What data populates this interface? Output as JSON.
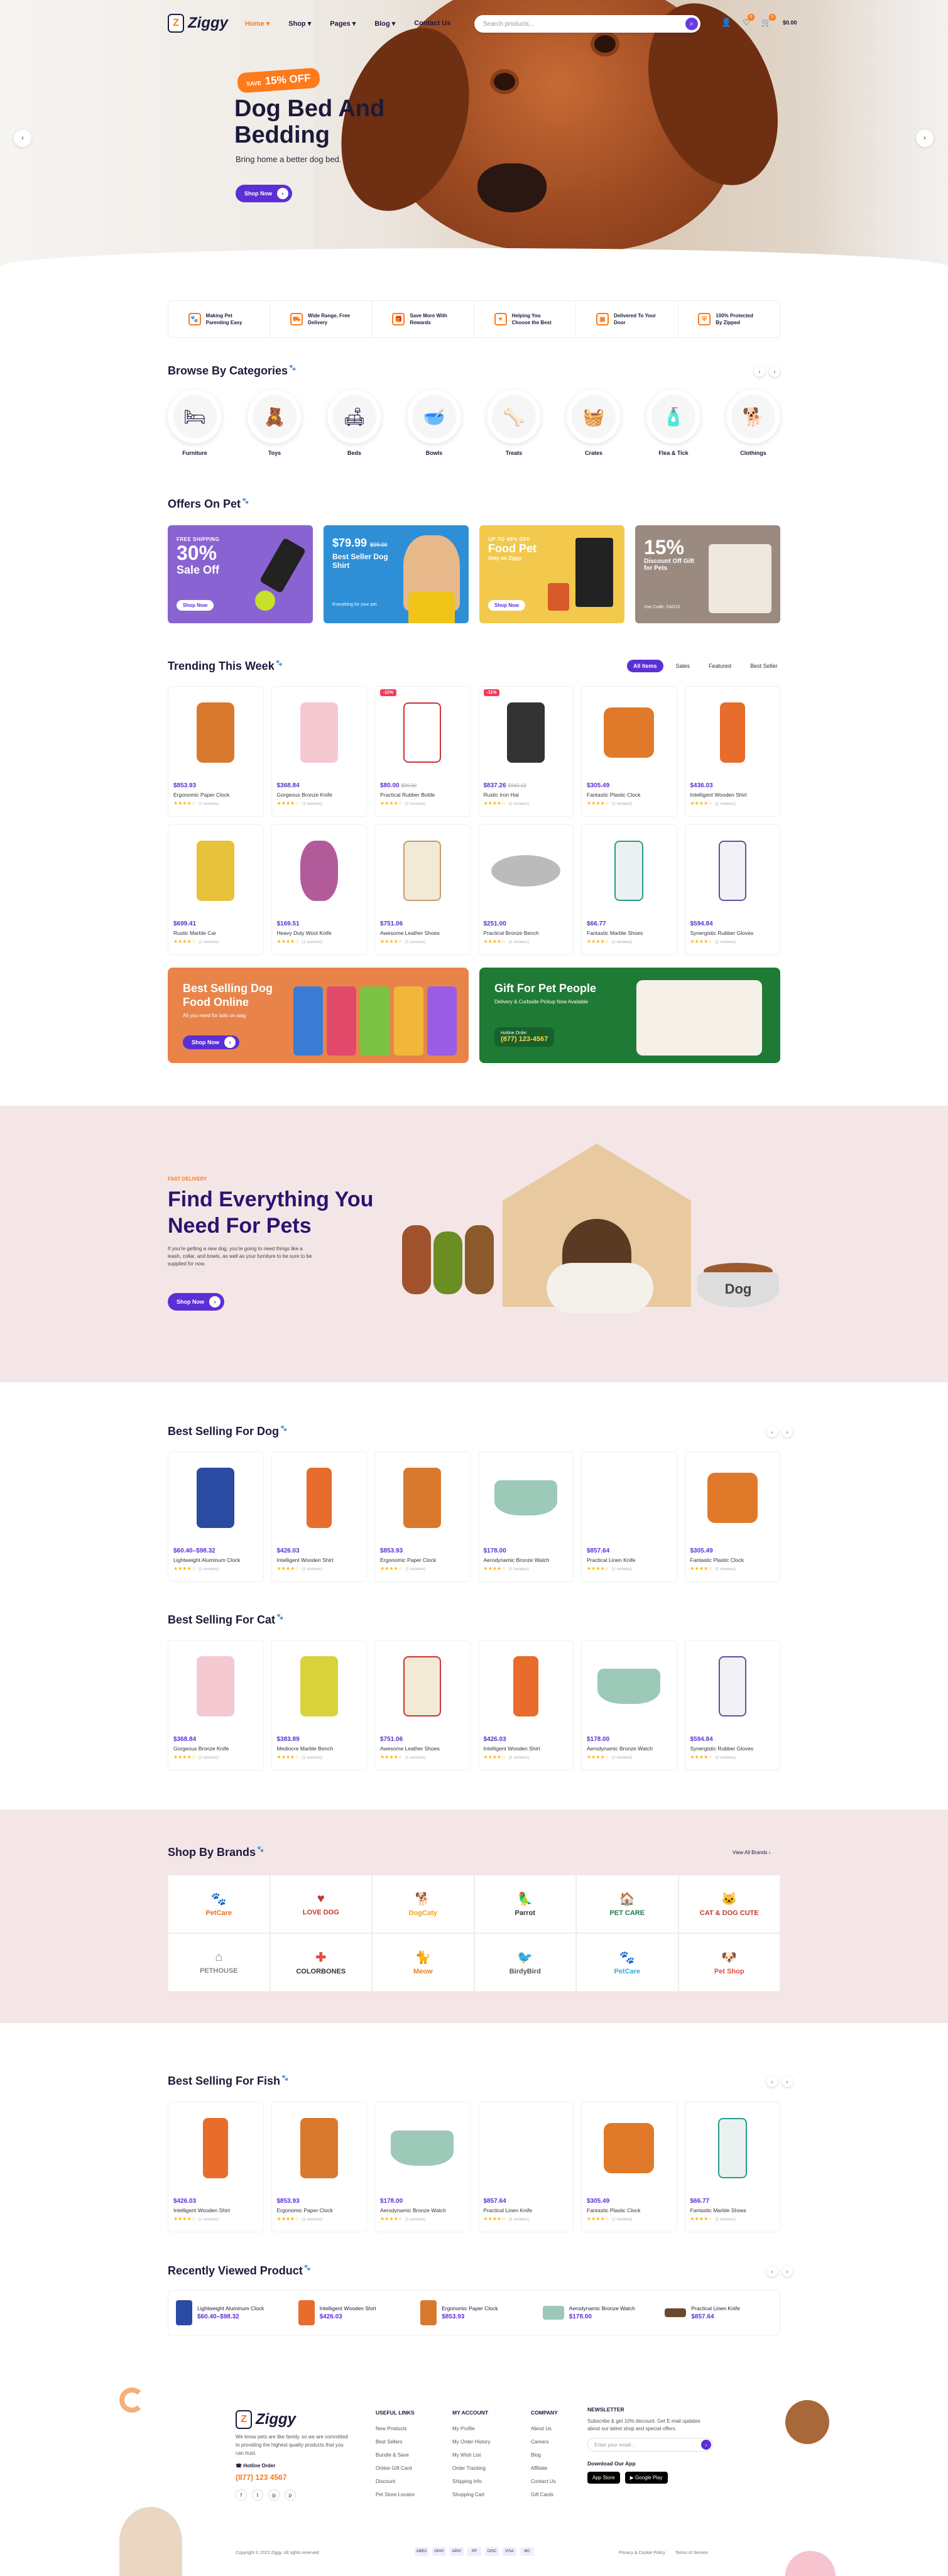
{
  "header": {
    "logo": "Ziggy",
    "nav": [
      "Home",
      "Shop",
      "Pages",
      "Blog",
      "Contact Us"
    ],
    "search_placeholder": "Search products...",
    "cart_total": "$0.00",
    "wishlist_count": "0",
    "cart_count": "0"
  },
  "hero": {
    "tag_small": "SAVE",
    "tag": "15% OFF",
    "title": "Dog Bed And Bedding",
    "subtitle": "Bring home a better dog bed.",
    "button": "Shop Now"
  },
  "features": [
    {
      "icon": "paw-icon",
      "text": "Making Pet Parenting Easy"
    },
    {
      "icon": "truck-icon",
      "text": "Wide Range, Free Delivery"
    },
    {
      "icon": "gift-icon",
      "text": "Save More With Rewards"
    },
    {
      "icon": "heart-icon",
      "text": "Helping You Choose the Best"
    },
    {
      "icon": "box-icon",
      "text": "Delivered To Your Door"
    },
    {
      "icon": "shield-icon",
      "text": "100% Protected By Zipped"
    }
  ],
  "categories_title": "Browse By Categories",
  "categories": [
    "Furniture",
    "Toys",
    "Beds",
    "Bowls",
    "Treats",
    "Crates",
    "Flea & Tick",
    "Clothings"
  ],
  "offers_title": "Offers On Pet",
  "offers": [
    {
      "line1": "FREE SHIPPING",
      "big": "30%",
      "line2": "Sale Off",
      "button": "Shop Now",
      "color": "#8a63d2"
    },
    {
      "line1": "",
      "big": "$79.99",
      "old": "$99.00",
      "line2": "Best Seller Dog Shirt",
      "note": "Everything for your pet.",
      "color": "#2f8fd6"
    },
    {
      "line1": "UP TO 40% OFF",
      "big": "Food Pet",
      "line2": "Only on Ziggy",
      "button": "Shop Now",
      "color": "#f2c94c"
    },
    {
      "line1": "",
      "big": "15%",
      "line2": "Discount Off Gift for Pets",
      "note": "Use Code: ZAG15",
      "color": "#9a8a80"
    }
  ],
  "trending_title": "Trending This Week",
  "trending_tabs": [
    "All Items",
    "Sales",
    "Featured",
    "Best Seller"
  ],
  "trending_row1": [
    {
      "price": "$853.93",
      "name": "Ergonomic Paper Clock",
      "sale": ""
    },
    {
      "price": "$368.84",
      "name": "Gorgeous Bronze Knife",
      "sale": ""
    },
    {
      "price": "$80.00",
      "old": "$90.00",
      "name": "Practical Rubber Bottle",
      "sale": "-11%"
    },
    {
      "price": "$837.26",
      "old": "$942.13",
      "name": "Rustic Iron Hat",
      "sale": "-11%"
    },
    {
      "price": "$305.49",
      "name": "Fantastic Plastic Clock",
      "sale": ""
    },
    {
      "price": "$436.03",
      "name": "Intelligent Wooden Shirt",
      "sale": ""
    }
  ],
  "trending_row2": [
    {
      "price": "$699.41",
      "name": "Rustic Marble Car"
    },
    {
      "price": "$169.51",
      "name": "Heavy Duty Wool Knife"
    },
    {
      "price": "$751.06",
      "name": "Awesome Leather Shoes"
    },
    {
      "price": "$251.00",
      "name": "Practical Bronze Bench"
    },
    {
      "price": "$66.77",
      "name": "Fantastic Marble Shoes"
    },
    {
      "price": "$594.84",
      "name": "Synergistic Rubber Gloves"
    }
  ],
  "reviews": "(1 reviews)",
  "promo_left": {
    "title": "Best Selling Dog Food Online",
    "sub": "All you need for tails on wag",
    "button": "Shop Now"
  },
  "promo_right": {
    "title": "Gift For Pet People",
    "sub": "Delivery & Curbside Pickup Now Available",
    "hotline_label": "Hotline Order",
    "hotline": "(877) 123-4567"
  },
  "find": {
    "tag": "FAST DELIVERY",
    "title": "Find Everything You Need For Pets",
    "text": "If you're getting a new dog, you're going to need things like a leash, collar, and bowls, as well as your furniture to be sure to be supplied for now.",
    "button": "Shop Now",
    "bowl_text": "Dog"
  },
  "dog_title": "Best Selling For Dog",
  "dog_products": [
    {
      "price": "$60.40–$98.32",
      "name": "Lightweight Aluminum Clock"
    },
    {
      "price": "$426.03",
      "name": "Intelligent Wooden Shirt"
    },
    {
      "price": "$853.93",
      "name": "Ergonomic Paper Clock"
    },
    {
      "price": "$178.00",
      "name": "Aerodynamic Bronze Watch"
    },
    {
      "price": "$857.64",
      "name": "Practical Linen Knife"
    },
    {
      "price": "$305.49",
      "name": "Fantastic Plastic Clock"
    }
  ],
  "cat_title": "Best Selling For Cat",
  "cat_products": [
    {
      "price": "$368.84",
      "name": "Gorgeous Bronze Knife"
    },
    {
      "price": "$383.89",
      "name": "Mediocre Marble Bench"
    },
    {
      "price": "$751.06",
      "name": "Awesome Leather Shoes"
    },
    {
      "price": "$426.03",
      "name": "Intelligent Wooden Shirt"
    },
    {
      "price": "$178.00",
      "name": "Aerodynamic Bronze Watch"
    },
    {
      "price": "$594.84",
      "name": "Synergistic Rubber Gloves"
    }
  ],
  "brands_title": "Shop By Brands",
  "brands_view_all": "View All Brands",
  "brands": [
    "PetCare",
    "LOVE DOG",
    "DogCaty",
    "Parrot",
    "PET CARE",
    "CAT & DOG CUTE",
    "PETHOUSE",
    "COLORBONES",
    "Meow",
    "BirdyBird",
    "PetCare",
    "Pet Shop"
  ],
  "fish_title": "Best Selling For Fish",
  "fish_products": [
    {
      "price": "$426.03",
      "name": "Intelligent Wooden Shirt"
    },
    {
      "price": "$853.93",
      "name": "Ergonomic Paper Clock"
    },
    {
      "price": "$178.00",
      "name": "Aerodynamic Bronze Watch"
    },
    {
      "price": "$857.64",
      "name": "Practical Linen Knife"
    },
    {
      "price": "$305.49",
      "name": "Fantastic Plastic Clock"
    },
    {
      "price": "$66.77",
      "name": "Fantastic Marble Shoes"
    }
  ],
  "recent_title": "Recently Viewed Product",
  "recent": [
    {
      "name": "Lightweight Aluminum Clock",
      "price": "$60.40–$98.32"
    },
    {
      "name": "Intelligent Wooden Shirt",
      "price": "$426.03"
    },
    {
      "name": "Ergonomic Paper Clock",
      "price": "$853.93"
    },
    {
      "name": "Aerodynamic Bronze Watch",
      "price": "$178.00"
    },
    {
      "name": "Practical Linen Knife",
      "price": "$857.64"
    }
  ],
  "footer": {
    "about": "We know pets are like family, so we are committed to providing the highest quality products that you can trust.",
    "hotline_label": "Hotline Order",
    "hotline": "(877) 123 4567",
    "useful_title": "USEFUL LINKS",
    "useful": [
      "New Products",
      "Best Sellers",
      "Bundle & Save",
      "Online Gift Card",
      "Discount",
      "Pet Store Locator"
    ],
    "account_title": "MY ACCOUNT",
    "account": [
      "My Profile",
      "My Order History",
      "My Wish List",
      "Order Tracking",
      "Shipping Info",
      "Shopping Cart"
    ],
    "company_title": "COMPANY",
    "company": [
      "About Us",
      "Careers",
      "Blog",
      "Affiliate",
      "Contact Us",
      "Gift Cards"
    ],
    "newsletter_title": "NEWSLETTER",
    "newsletter_text": "Subscribe & get 10% discount. Get E-mail updates about our latest shop and special offers.",
    "newsletter_placeholder": "Enter your email...",
    "app_title": "Download Our App",
    "app_store": "App Store",
    "google_play": "Google Play",
    "copyright": "Copyright © 2023 Ziggy. All rights reserved",
    "privacy": "Privacy & Cookie Policy",
    "terms": "Terms of Service",
    "payments": [
      "AMEX",
      "GPAY",
      "APAY",
      "PP",
      "DISC",
      "VISA",
      "MC"
    ]
  }
}
